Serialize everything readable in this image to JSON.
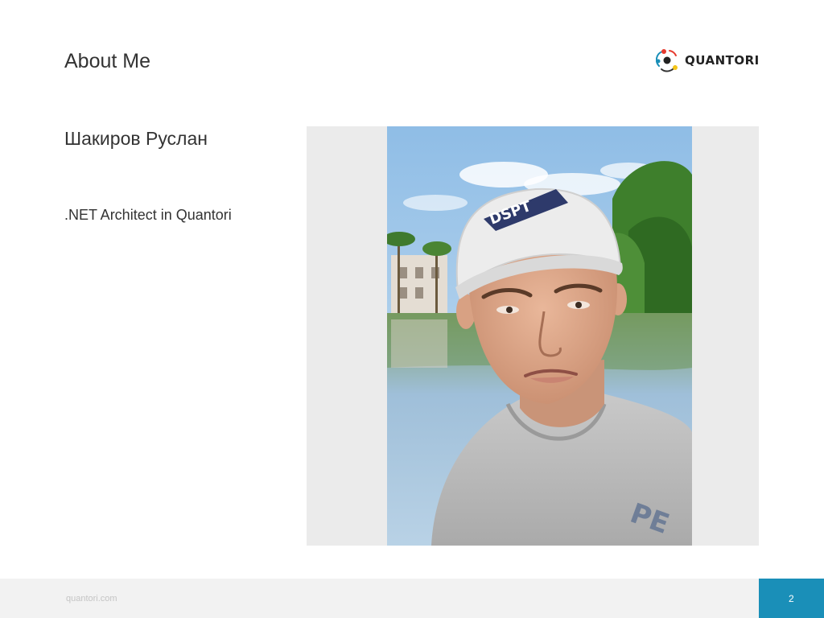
{
  "slide": {
    "title": "About Me",
    "name": "Шакиров Руслан",
    "role": ".NET Architect in Quantori"
  },
  "logo": {
    "text": "QUANTORI",
    "icon": "quantori-logo-icon",
    "colors": {
      "red": "#e63a2e",
      "blue": "#1a8fb8",
      "yellow": "#f5c518",
      "dark": "#222222"
    }
  },
  "photo": {
    "icon": "portrait-photo",
    "cap_text": "DSPT"
  },
  "footer": {
    "site": "quantori.com",
    "page": "2",
    "accent_color": "#1a8fb8"
  }
}
